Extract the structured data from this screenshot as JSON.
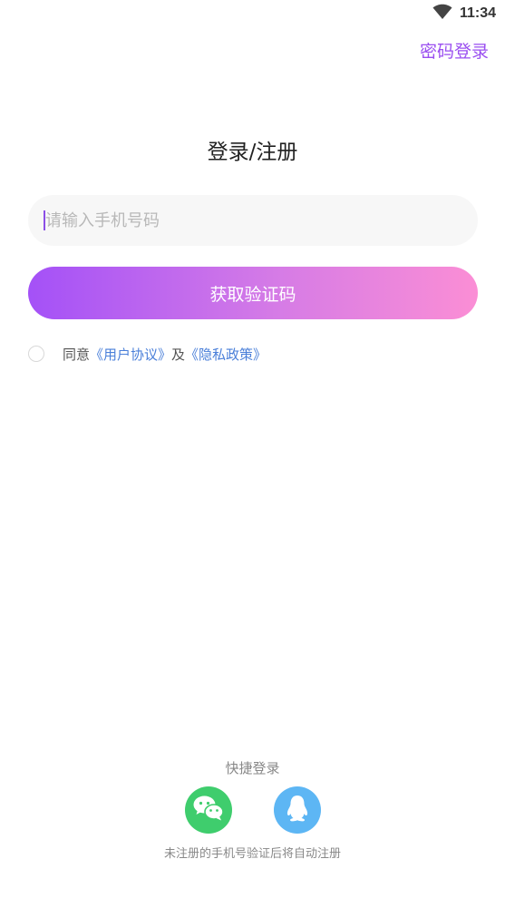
{
  "status_bar": {
    "time": "11:34",
    "wifi_icon": "wifi-icon"
  },
  "header": {
    "password_login": "密码登录"
  },
  "title": "登录/注册",
  "phone": {
    "placeholder": "请输入手机号码",
    "value": ""
  },
  "code_button": {
    "label": "获取验证码"
  },
  "agreement": {
    "checked": false,
    "prefix": "同意",
    "user_agreement": "《用户协议》",
    "and": "及",
    "privacy_policy": "《隐私政策》"
  },
  "quick_login": {
    "title": "快捷登录",
    "wechat_icon": "wechat-icon",
    "qq_icon": "qq-icon",
    "note": "未注册的手机号验证后将自动注册"
  },
  "colors": {
    "accent": "#9a4ef0",
    "gradient_start": "#a451f7",
    "gradient_end": "#fb8ed5",
    "link": "#4a7fd9",
    "wechat": "#3fcd6d",
    "qq": "#5db6f4"
  }
}
